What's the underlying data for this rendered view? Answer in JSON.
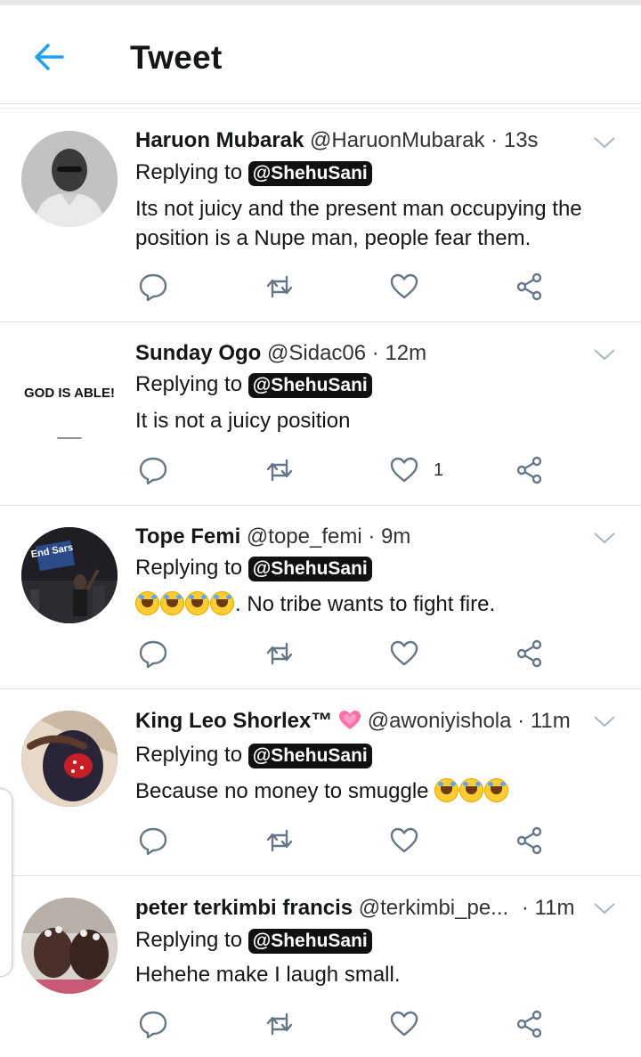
{
  "header": {
    "title": "Tweet"
  },
  "colors": {
    "accent": "#1da1f2",
    "icon_gray": "#657786",
    "text": "#14171a"
  },
  "tweets": [
    {
      "name": "Haruon Mubarak",
      "handle": "@HaruonMubarak",
      "dot": "·",
      "time": "13s",
      "replying_label": "Replying to",
      "replying_to": "@ShehuSani",
      "text": "Its not juicy and the present man occupying the position is a Nupe man, people fear them.",
      "like_count": ""
    },
    {
      "name": "Sunday Ogo",
      "handle": "@Sidac06",
      "dot": "·",
      "time": "12m",
      "replying_label": "Replying to",
      "replying_to": "@ShehuSani",
      "avatar_text": "GOD IS ABLE!",
      "text": "It is not a juicy position",
      "like_count": "1"
    },
    {
      "name": "Tope Femi",
      "handle": "@tope_femi",
      "dot": "·",
      "time": "9m",
      "replying_label": "Replying to",
      "replying_to": "@ShehuSani",
      "avatar_text": "End Sars",
      "text": ". No tribe wants to fight fire.",
      "emoji_count": 4,
      "like_count": ""
    },
    {
      "name": "King Leo Shorlex™",
      "handle": "@awoniyishola",
      "dot": "·",
      "time": "11m",
      "replying_label": "Replying to",
      "replying_to": "@ShehuSani",
      "text": "Because no money to smuggle",
      "emoji_count": 3,
      "like_count": ""
    },
    {
      "name": "peter terkimbi francis",
      "handle": "@terkimbi_pe...",
      "dot": "·",
      "time": "11m",
      "replying_label": "Replying to",
      "replying_to": "@ShehuSani",
      "text": "Hehehe make I laugh small.",
      "like_count": ""
    }
  ],
  "icons": [
    "back-arrow-icon",
    "chevron-down-icon",
    "reply-icon",
    "retweet-icon",
    "like-icon",
    "share-icon"
  ]
}
